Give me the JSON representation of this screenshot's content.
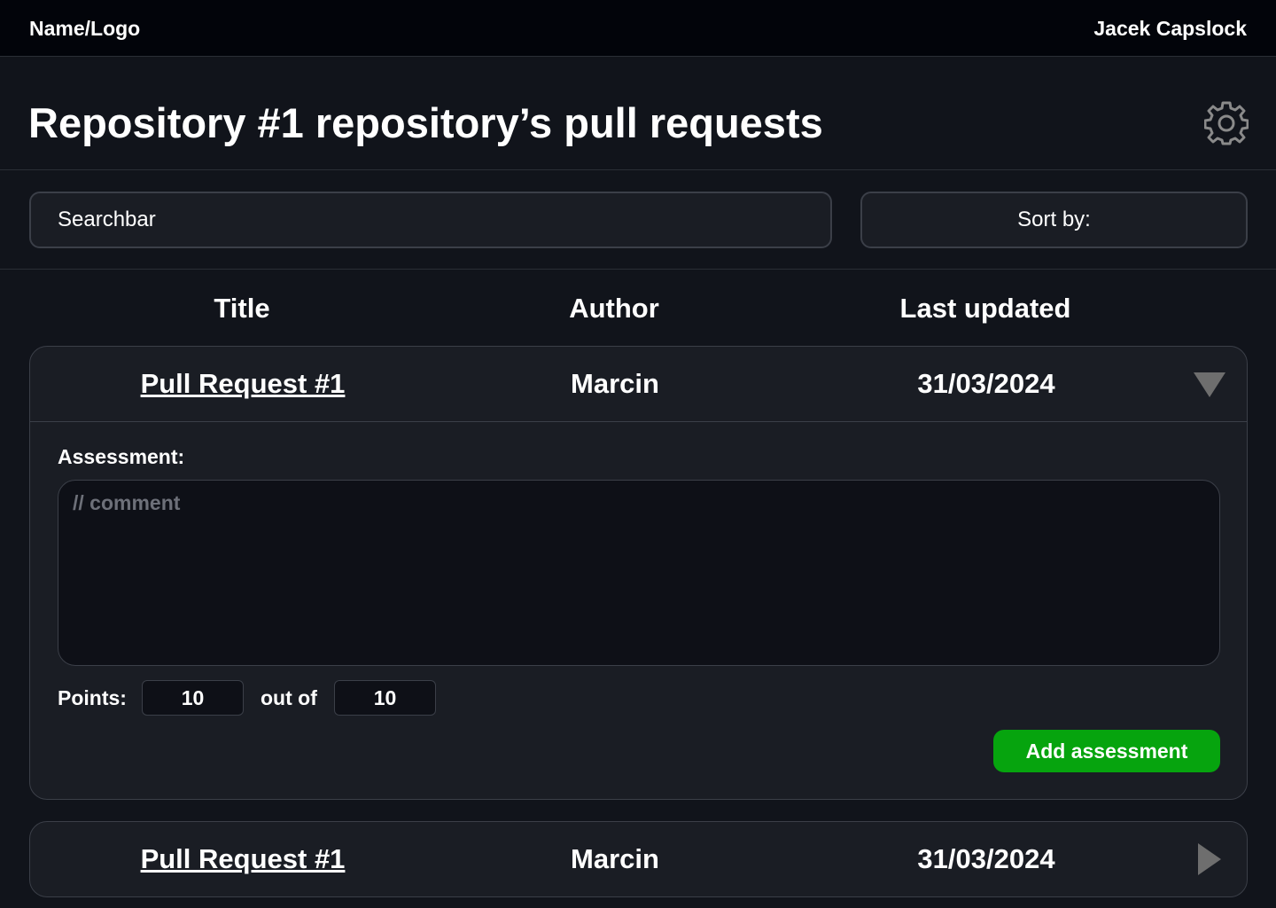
{
  "topbar": {
    "brand": "Name/Logo",
    "user_name": "Jacek Capslock"
  },
  "header": {
    "title": "Repository #1 repository’s pull requests",
    "settings_icon": "gear-icon"
  },
  "toolbar": {
    "search_placeholder": "Searchbar",
    "sort_label": "Sort by:"
  },
  "table": {
    "columns": [
      "Title",
      "Author",
      "Last updated"
    ],
    "rows": [
      {
        "title": "Pull Request #1",
        "author": "Marcin",
        "last_updated": "31/03/2024",
        "expanded": true,
        "toggle_icon": "triangle-down-icon"
      },
      {
        "title": "Pull Request #1",
        "author": "Marcin",
        "last_updated": "31/03/2024",
        "expanded": false,
        "toggle_icon": "triangle-right-icon"
      }
    ]
  },
  "assessment": {
    "label": "Assessment:",
    "comment_placeholder": "// comment",
    "points_label": "Points:",
    "points_value": "10",
    "out_of_label": "out of",
    "max_points_value": "10",
    "submit_label": "Add assessment"
  },
  "colors": {
    "page_bg": "#11141b",
    "topbar_bg": "#02040a",
    "card_bg": "#1a1d24",
    "border": "#3b3f48",
    "accent_green": "#06a40e",
    "icon_gray": "#6e6e6e"
  }
}
